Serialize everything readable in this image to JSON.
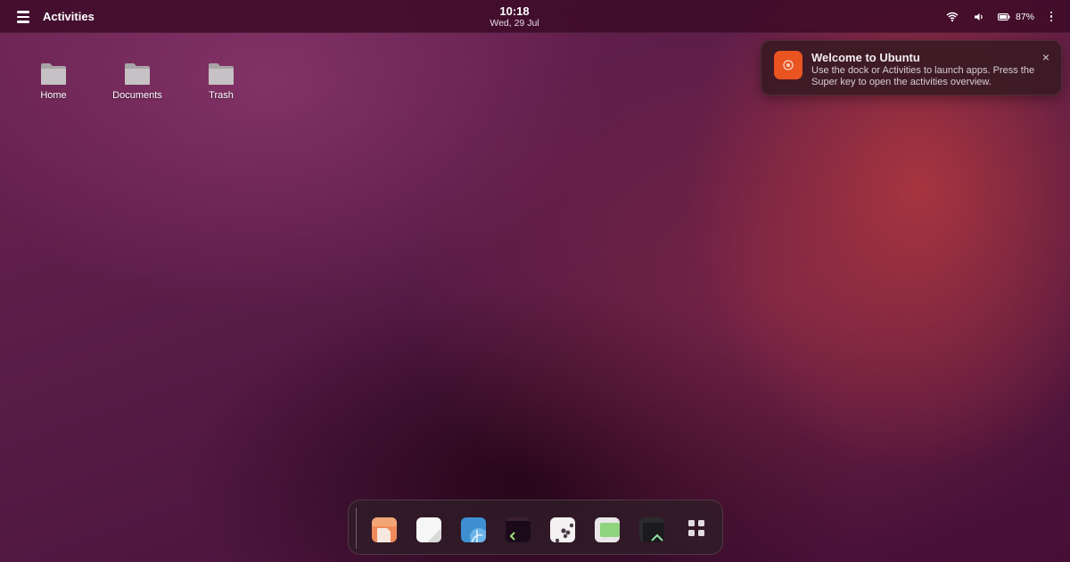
{
  "topbar": {
    "activities_label": "Activities",
    "clock_time": "10:18",
    "clock_date": "Wed, 29 Jul",
    "battery_percent": "87%",
    "battery_level": 0.87
  },
  "desktop": {
    "icons": [
      {
        "label": "Home",
        "icon": "folder-icon"
      },
      {
        "label": "Documents",
        "icon": "folder-icon"
      },
      {
        "label": "Trash",
        "icon": "folder-icon"
      }
    ]
  },
  "notification": {
    "title": "Welcome to Ubuntu",
    "body": "Use the dock or Activities to launch apps. Press the Super key to open the activities overview.",
    "icon": "ubuntu-icon",
    "close": "×",
    "accent": "#e95420"
  },
  "dock": {
    "apps": [
      {
        "icon": "files-app-icon"
      },
      {
        "icon": "text-editor-app-icon"
      },
      {
        "icon": "browser-app-icon"
      },
      {
        "icon": "terminal-app-icon"
      },
      {
        "icon": "settings-app-icon"
      },
      {
        "icon": "image-viewer-app-icon"
      },
      {
        "icon": "system-monitor-app-icon"
      }
    ],
    "show_apps_icon": "app-grid-icon"
  },
  "colors": {
    "wallpaper_base": "#5c1d49",
    "wallpaper_glow": "#b2383e",
    "ubuntu_orange": "#e95420"
  }
}
